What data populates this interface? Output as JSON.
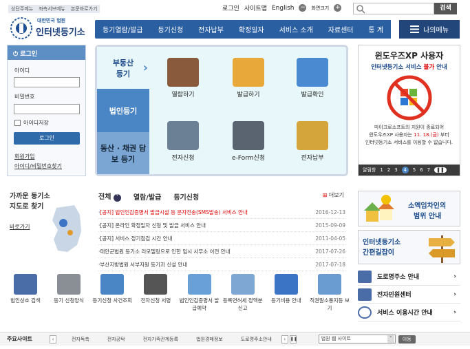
{
  "header": {
    "skip_links": [
      "상단주메뉴",
      "좌측서브메뉴",
      "본문바로가기"
    ],
    "utils": [
      "로그인",
      "사이트맵",
      "English",
      "화면크기"
    ],
    "search_button": "검색",
    "logo_small": "대한민국 법원",
    "logo_big": "인터넷등기소"
  },
  "nav": {
    "items": [
      "등기열람/발급",
      "등기신청",
      "전자납부",
      "확정일자",
      "서비스 소개",
      "자료센터",
      "통 계"
    ],
    "my_menu": "나의메뉴"
  },
  "login": {
    "title": "로그인",
    "id_label": "아이디",
    "pw_label": "비밀번호",
    "save_id": "아이디저장",
    "button": "로그인",
    "links": [
      "회원가입",
      "아이디/비밀번호찾기"
    ]
  },
  "main_panel": {
    "left": [
      "부동산 등기",
      "법인등기",
      "동산 · 채권 담보 등기"
    ],
    "services": [
      "열람하기",
      "발급하기",
      "발급확인",
      "전자신청",
      "e-Form신청",
      "전자납부"
    ]
  },
  "ad": {
    "line1": "윈도우즈XP 사용자",
    "line2a": "인터넷등기소 서비스",
    "line2b": "불가",
    "line2c": "안내",
    "body1": "마이크로소프트의 지원이 종료되어",
    "body2a": "윈도우즈XP 사용자는",
    "body2b": "11. 18.(금)",
    "body2c": "부터",
    "body3": "인터넷등기소 서비스를 이용할 수 없습니다.",
    "bar_label": "알림창",
    "pages": [
      "1",
      "2",
      "3",
      "4",
      "5",
      "6",
      "7"
    ]
  },
  "find": {
    "title1": "가까운 등기소",
    "title2": "지도로 찾기",
    "link": "바로가기"
  },
  "news": {
    "tabs": [
      "전체",
      "열람/발급",
      "등기신청"
    ],
    "more": "더보기",
    "items": [
      {
        "text": "[공지] 법인인감증명서 발급시설 등 문자전송(SMS발송) 서비스 안내",
        "date": "2016-12-13",
        "hot": true
      },
      {
        "text": "[공지] 온라인 확정일자 신청 및 발급 서비스 안내",
        "date": "2015-09-09",
        "hot": false
      },
      {
        "text": "[공지] 서비스 정기점검 시간 안내",
        "date": "2011-04-05",
        "hot": false
      },
      {
        "text": "태안군법원 등기소 리모델링으로 인한 임시 사무소 이전 안내",
        "date": "2017-07-26",
        "hot": false
      },
      {
        "text": "부산지방법원 서부지원 등기과 신설 안내",
        "date": "2017-07-18",
        "hot": false
      }
    ]
  },
  "right_boxes": {
    "box1a": "소액임차인의",
    "box1b": "범위 안내",
    "box2a": "인터넷등기소",
    "box2b": "간편길잡이",
    "list": [
      "도로명주소 안내",
      "전자민원센터",
      "서비스 이용시간 안내"
    ]
  },
  "quick": [
    "법인상호 검색",
    "등기 신청양식",
    "등기신청 사건조회",
    "전자신청 서명",
    "법인인감증명서 발급예약",
    "등록면허세 정액분 신고",
    "등기비용 안내",
    "직권말소통지등 보기"
  ],
  "footer": {
    "label": "주요사이트",
    "links": [
      "전자독촉",
      "전자공탁",
      "전자가족관계등록",
      "법원경매정보",
      "도로명주소안내"
    ],
    "select": "법원 웹 사이트",
    "go": "이동"
  }
}
